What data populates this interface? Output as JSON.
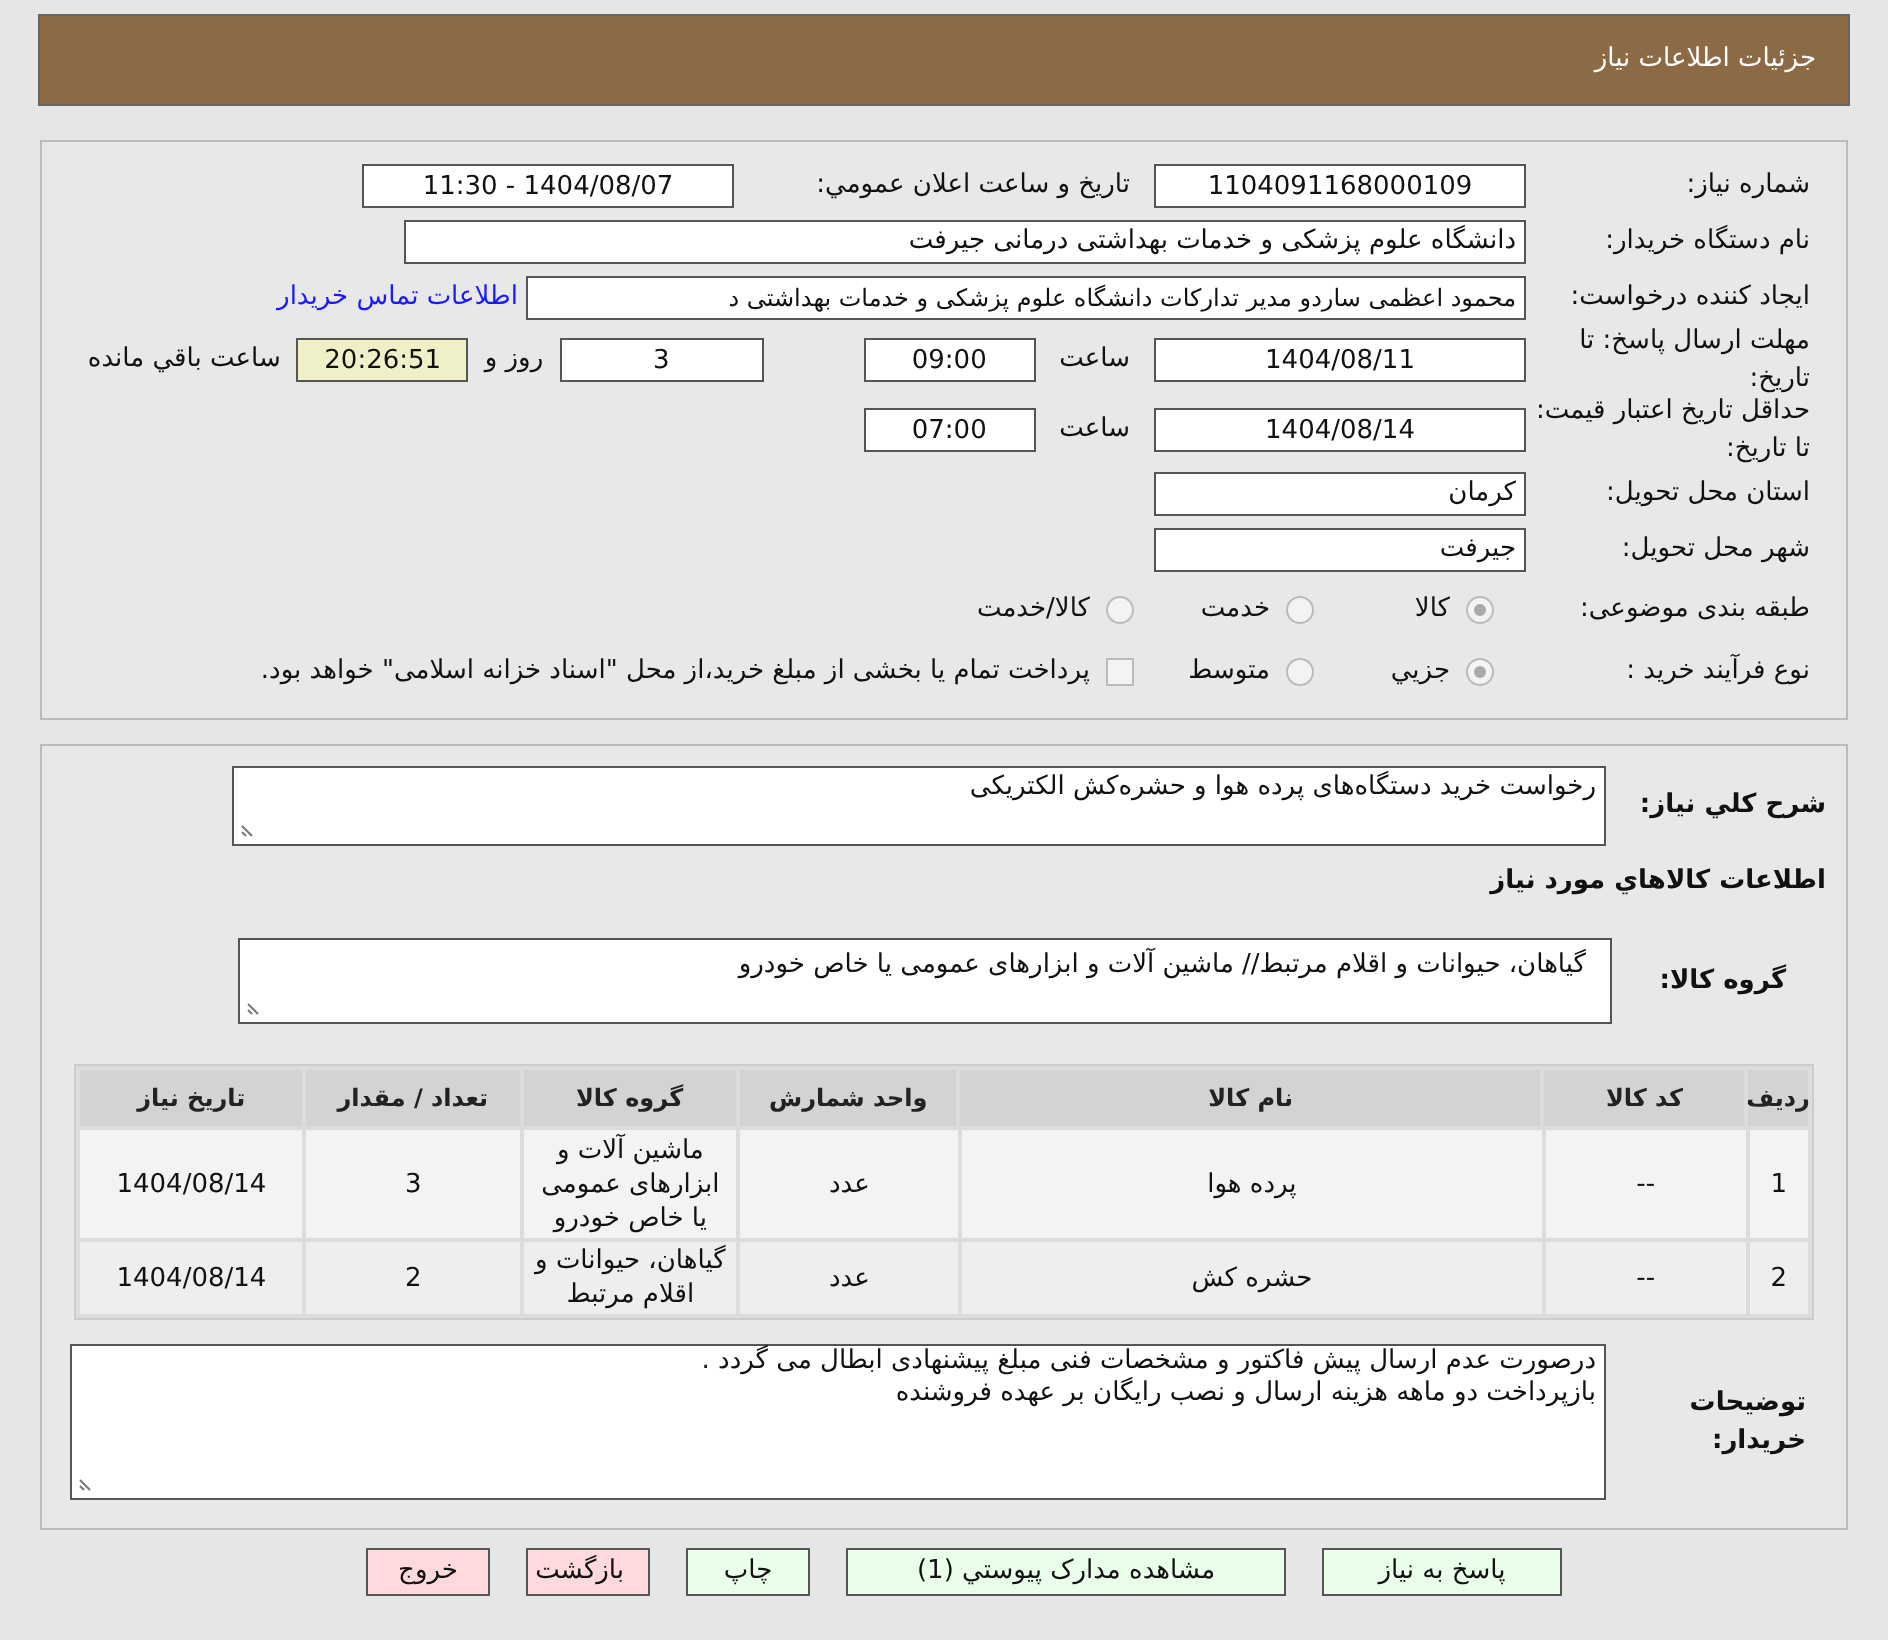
{
  "header": {
    "title": "جزئیات اطلاعات نیاز"
  },
  "need_number": {
    "label": "شماره نیاز:",
    "value": "1104091168000109"
  },
  "announce": {
    "label": "تاریخ و ساعت اعلان عمومي:",
    "value": "1404/08/07 - 11:30"
  },
  "buyer_org": {
    "label": "نام دستگاه خریدار:",
    "value": "دانشگاه علوم پزشکی و خدمات بهداشتی درمانی جیرفت"
  },
  "requester": {
    "label": "ایجاد کننده درخواست:",
    "value": "محمود اعظمی ساردو مدیر تدارکات دانشگاه علوم پزشکی و خدمات بهداشتی د",
    "link": "اطلاعات تماس خریدار"
  },
  "deadline": {
    "label": "مهلت ارسال پاسخ: تا تاریخ:",
    "date": "1404/08/11",
    "time_label": "ساعت",
    "time": "09:00",
    "days": "3",
    "days_label": "روز و",
    "remaining": "20:26:51",
    "remaining_label": "ساعت باقي مانده"
  },
  "validity": {
    "label": "حداقل تاریخ اعتبار قیمت: تا تاریخ:",
    "date": "1404/08/14",
    "time_label": "ساعت",
    "time": "07:00"
  },
  "province": {
    "label": "استان محل تحویل:",
    "value": "کرمان"
  },
  "city": {
    "label": "شهر محل تحویل:",
    "value": "جیرفت"
  },
  "category": {
    "label": "طبقه بندی موضوعی:",
    "options": [
      {
        "label": "کالا",
        "selected": true
      },
      {
        "label": "خدمت",
        "selected": false
      },
      {
        "label": "کالا/خدمت",
        "selected": false
      }
    ]
  },
  "purchase_type": {
    "label": "نوع فرآیند خرید :",
    "options": [
      {
        "label": "جزيي",
        "selected": true
      },
      {
        "label": "متوسط",
        "selected": false
      }
    ],
    "treasury": {
      "label": "پرداخت تمام یا بخشی از مبلغ خرید،از محل \"اسناد خزانه اسلامی\" خواهد بود.",
      "checked": false
    }
  },
  "description": {
    "label": "شرح كلي نياز:",
    "value": "رخواست خرید دستگاه‌های پرده هوا و حشره‌کش الکتریکی"
  },
  "goods_title": "اطلاعات كالاهاي مورد نياز",
  "goods_group": {
    "label": "گروه کالا:",
    "value": "گیاهان، حیوانات و اقلام مرتبط//  ماشین آلات و ابزارهای عمومی یا خاص خودرو"
  },
  "table": {
    "columns": [
      "ردیف",
      "کد کالا",
      "نام کالا",
      "واحد شمارش",
      "گروه کالا",
      "تعداد / مقدار",
      "تاریخ نیاز"
    ],
    "rows": [
      {
        "cells": [
          "1",
          "--",
          "پرده هوا",
          "عدد",
          "ماشین آلات و ابزارهای عمومی یا خاص خودرو",
          "3",
          "1404/08/14"
        ]
      },
      {
        "cells": [
          "2",
          "--",
          "حشره کش",
          "عدد",
          "گیاهان، حیوانات و اقلام مرتبط",
          "2",
          "1404/08/14"
        ]
      }
    ]
  },
  "buyer_notes": {
    "label": "توضیحات خریدار:",
    "lines": [
      "درصورت عدم ارسال پیش فاکتور و مشخصات فنی مبلغ پیشنهادی ابطال می گردد .",
      "بازپرداخت دو ماهه هزینه ارسال  و نصب رایگان بر عهده فروشنده"
    ]
  },
  "buttons": [
    {
      "label": "پاسخ به نیاز",
      "kind": "primary"
    },
    {
      "label": "مشاهده مدارک پیوستي (1)",
      "kind": "primary"
    },
    {
      "label": "چاپ",
      "kind": "primary"
    },
    {
      "label": "بازگشت",
      "kind": "danger"
    },
    {
      "label": "خروج",
      "kind": "danger"
    }
  ]
}
